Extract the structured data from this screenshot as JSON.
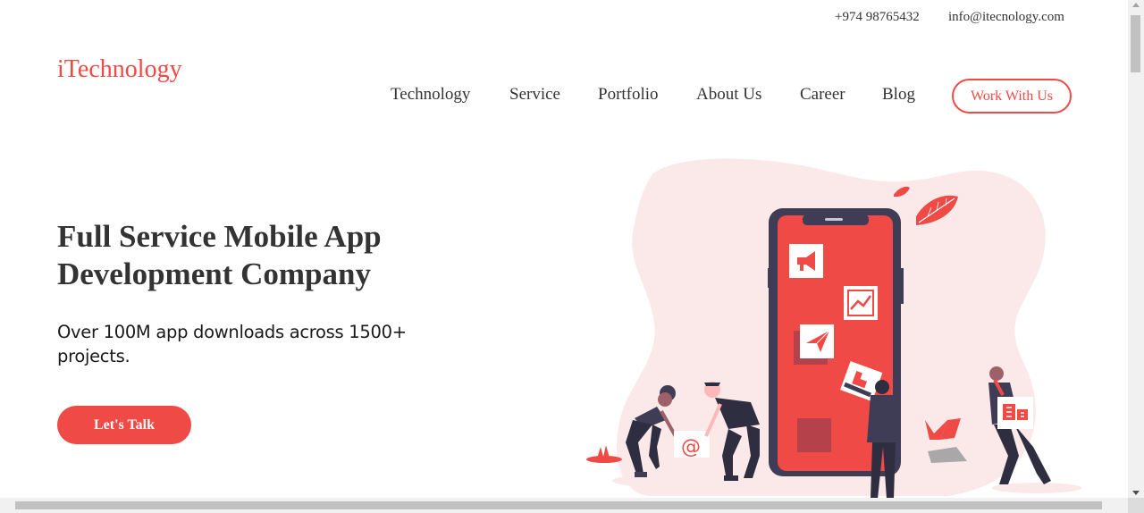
{
  "topbar": {
    "phone": "+974 98765432",
    "email": "info@itecnology.com"
  },
  "logo": "iTechnology",
  "nav": {
    "items": [
      {
        "label": "Technology"
      },
      {
        "label": "Service"
      },
      {
        "label": "Portfolio"
      },
      {
        "label": "About Us"
      },
      {
        "label": "Career"
      },
      {
        "label": "Blog"
      }
    ],
    "cta": "Work With Us"
  },
  "hero": {
    "title_line1": "Full Service Mobile App",
    "title_line2": "Development Company",
    "subtitle": "Over 100M app downloads across 1500+ projects.",
    "button": "Let's Talk"
  },
  "illustration": {
    "at_symbol": "@"
  },
  "colors": {
    "accent": "#ef4a45",
    "blob": "#fbe9e9",
    "phone_frame": "#3f3d56",
    "text": "#333333"
  }
}
